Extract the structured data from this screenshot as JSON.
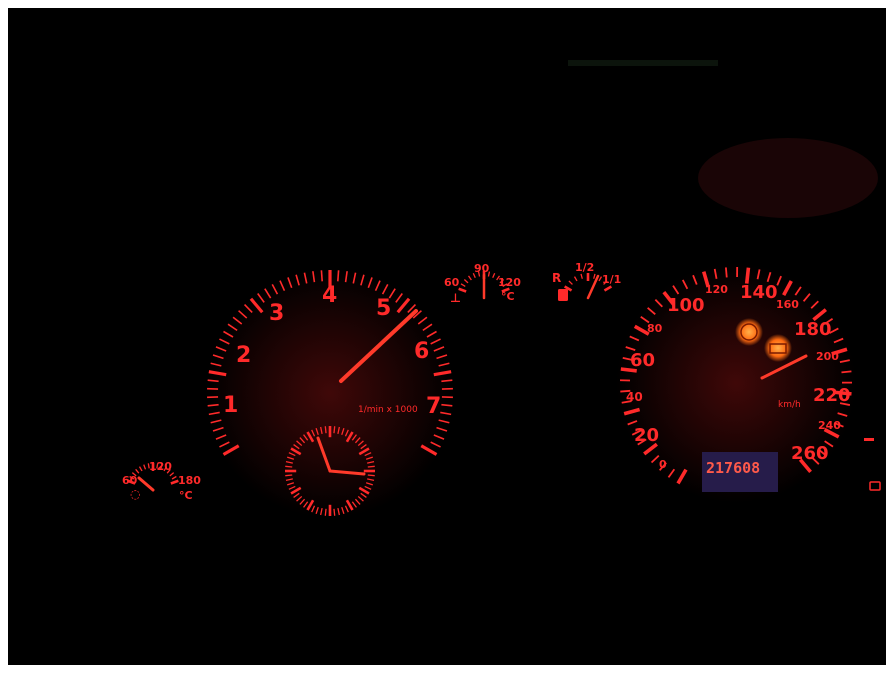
{
  "tachometer": {
    "ticks": [
      "1",
      "2",
      "3",
      "4",
      "5",
      "6",
      "7"
    ],
    "unit": "1/min x 1000"
  },
  "speedometer": {
    "ticks": [
      "0",
      "20",
      "40",
      "60",
      "80",
      "100",
      "120",
      "140",
      "160",
      "180",
      "200",
      "220",
      "240",
      "260"
    ],
    "unit": "km/h"
  },
  "oil_temp": {
    "ticks": [
      "60",
      "120",
      "180"
    ],
    "unit": "°C"
  },
  "coolant_temp": {
    "ticks": [
      "60",
      "90",
      "120"
    ],
    "unit": "°C"
  },
  "fuel": {
    "ticks": [
      "R",
      "1/2",
      "1/1"
    ]
  },
  "odometer": {
    "value": "217608"
  },
  "warning_lights": [
    "parking-brake",
    "battery"
  ],
  "colors": {
    "backlight": "#ff2a2a",
    "warning": "#ff7a1a",
    "lcd": "#3a2a6a"
  }
}
